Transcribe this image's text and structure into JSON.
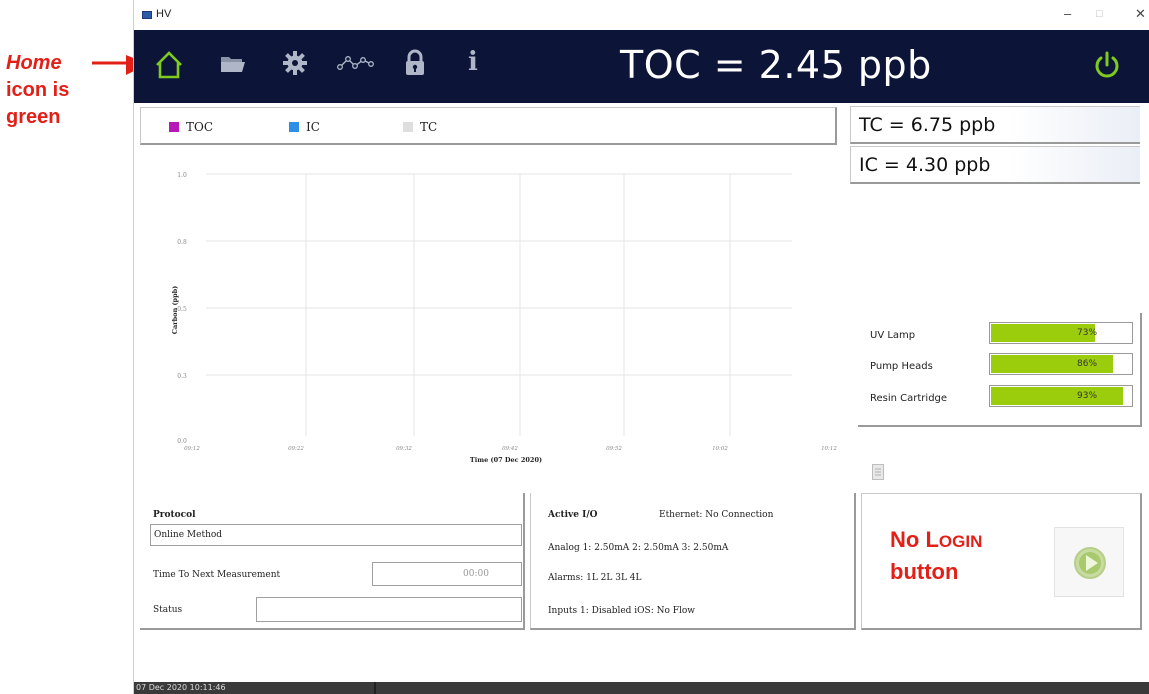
{
  "annotations": {
    "home_line1": "Home",
    "home_line2": "icon is",
    "home_line3": "green",
    "login_line1_a": "No ",
    "login_line1_b": "L",
    "login_line1_c": "OGIN",
    "login_line2": "button",
    "color": "#e32017"
  },
  "window": {
    "title": "HV",
    "minimize": "–",
    "maximize": "□",
    "close": "✕"
  },
  "navbar": {
    "background": "#0c1437",
    "icons": [
      "home-icon",
      "folder-icon",
      "gear-icon",
      "trend-icon",
      "lock-icon",
      "info-icon",
      "power-icon"
    ],
    "home_icon_color": "#7ecb1e",
    "info_glyph": "i",
    "toc_text": "TOC = 2.45 ppb"
  },
  "legend": {
    "items": [
      {
        "label": "TOC",
        "color": "#b619b8"
      },
      {
        "label": "IC",
        "color": "#2e8fe6"
      },
      {
        "label": "TC",
        "color": "#dedede"
      }
    ]
  },
  "chart_data": {
    "type": "line",
    "ylabel": "Carbon (ppb)",
    "xlabel": "Time (07 Dec 2020)",
    "y_ticks": [
      "1.0",
      "0.8",
      "0.5",
      "0.3",
      "0.0"
    ],
    "x_ticks": [
      "09:12",
      "09:22",
      "09:32",
      "09:42",
      "09:52",
      "10:02",
      "10:12"
    ],
    "ylim": [
      0,
      1
    ],
    "grid": true,
    "series": []
  },
  "readouts": {
    "tc": "TC = 6.75 ppb",
    "ic": "IC = 4.30 ppb"
  },
  "consumables": [
    {
      "label": "UV Lamp",
      "percent_text": "73%",
      "fill": 0.73
    },
    {
      "label": "Pump Heads",
      "percent_text": "86%",
      "fill": 0.86
    },
    {
      "label": "Resin Cartridge",
      "percent_text": "93%",
      "fill": 0.93
    }
  ],
  "protocol": {
    "title": "Protocol",
    "method": "Online Method",
    "next_label": "Time To Next Measurement",
    "next_value": "00:00",
    "status_label": "Status",
    "status_value": ""
  },
  "active_io": {
    "title": "Active I/O",
    "ethernet": "Ethernet: No Connection",
    "analog": "Analog 1: 2.50mA  2: 2.50mA  3: 2.50mA",
    "alarms": "Alarms: 1L 2L 3L 4L",
    "inputs": "Inputs 1: Disabled  iOS: No Flow"
  },
  "taskbar": {
    "clock": "07 Dec 2020  10:11:46"
  }
}
